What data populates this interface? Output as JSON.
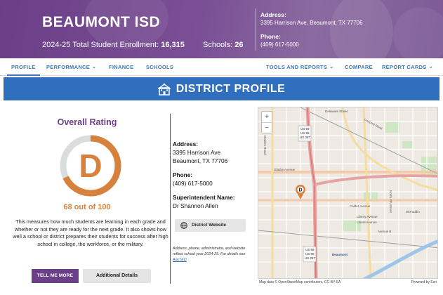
{
  "header": {
    "district_name": "BEAUMONT ISD",
    "enrollment_label": "2024-25 Total Student Enrollment:",
    "enrollment_value": "16,315",
    "schools_label": "Schools:",
    "schools_value": "26",
    "address_label": "Address:",
    "address_value": "3395 Harrison Ave, Beaumont, TX 77706",
    "phone_label": "Phone:",
    "phone_value": "(409) 617-5000"
  },
  "nav": {
    "profile": "PROFILE",
    "performance": "PERFORMANCE",
    "finance": "FINANCE",
    "schools": "SCHOOLS",
    "tools": "TOOLS AND REPORTS",
    "compare": "COMPARE",
    "report_cards": "REPORT CARDS"
  },
  "banner": {
    "title": "DISTRICT PROFILE"
  },
  "rating": {
    "title": "Overall Rating",
    "grade": "D",
    "score_text": "68 out of 100",
    "score": 68,
    "max": 100,
    "description": "This measures how much students are learning in each grade and whether or not they are ready for the next grade. It also shows how well a school or district prepares their students for success after high school in college, the workforce, or the military.",
    "tell_me_more": "TELL ME MORE",
    "additional_details": "Additional Details"
  },
  "info": {
    "address_label": "Address:",
    "address_line1": "3395 Harrison Ave",
    "address_line2": "Beaumont, TX 77706",
    "phone_label": "Phone:",
    "phone_value": "(409) 617-5000",
    "superintendent_label": "Superintendent Name:",
    "superintendent_value": "Dr Shannon Allen",
    "website_button": "District Website",
    "note_text": "Address, phone, administrator, and website reflect school year 2024-25. For details see",
    "note_link": "AskTED"
  },
  "map": {
    "zoom_in": "+",
    "zoom_out": "−",
    "attribution": "Map data © OpenStreetMap contributors, CC-BY-SA",
    "powered_by": "Powered by Esri",
    "marker_label": "D",
    "street_labels": [
      "Delaware Street",
      "Concord Road",
      "Gladys Avenue",
      "Calder Avenue",
      "Liberty Avenue",
      "Laurel Avenue",
      "Beaumont",
      "Avenue B",
      "North 4th Street",
      "McFaddin",
      "Dowlen Road",
      "US 69",
      "US 96",
      "US 287"
    ]
  },
  "colors": {
    "header_purple": "#6a3f87",
    "nav_blue": "#3e78b5",
    "banner_blue": "#2f6fbe",
    "grade_orange": "#d6823d",
    "track_gray": "#d9dedc"
  }
}
